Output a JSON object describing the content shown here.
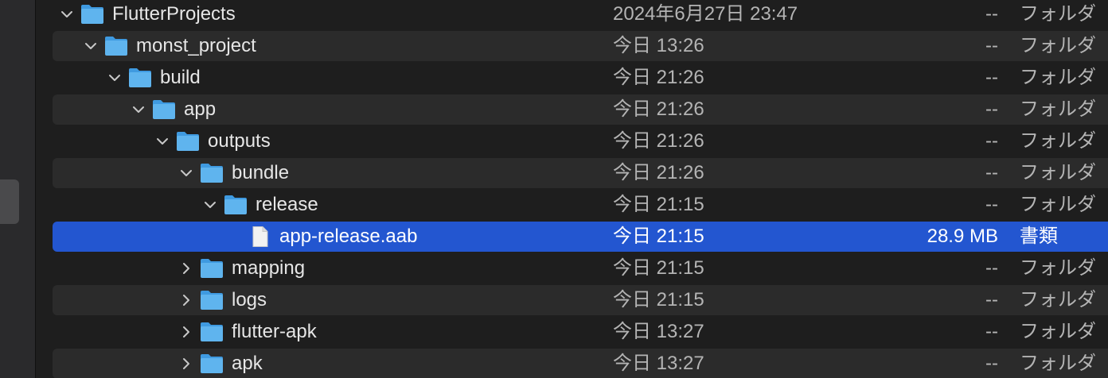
{
  "colors": {
    "background": "#1e1e1e",
    "alt_row": "#2b2b2b",
    "selection": "#2356d0",
    "folder_front": "#5fb4ee",
    "folder_back": "#3f9ae0",
    "text": "#e6e6e6",
    "secondary_text": "#b4b4b4"
  },
  "rows": [
    {
      "name": "FlutterProjects",
      "date": "2024年6月27日 23:47",
      "size": "--",
      "kind": "フォルダ",
      "icon": "folder-icon",
      "disclosure": "expanded",
      "level": 0
    },
    {
      "name": "monst_project",
      "date": "今日 13:26",
      "size": "--",
      "kind": "フォルダ",
      "icon": "folder-icon",
      "disclosure": "expanded",
      "level": 1
    },
    {
      "name": "build",
      "date": "今日 21:26",
      "size": "--",
      "kind": "フォルダ",
      "icon": "folder-icon",
      "disclosure": "expanded",
      "level": 2
    },
    {
      "name": "app",
      "date": "今日 21:26",
      "size": "--",
      "kind": "フォルダ",
      "icon": "folder-icon",
      "disclosure": "expanded",
      "level": 3
    },
    {
      "name": "outputs",
      "date": "今日 21:26",
      "size": "--",
      "kind": "フォルダ",
      "icon": "folder-icon",
      "disclosure": "expanded",
      "level": 4
    },
    {
      "name": "bundle",
      "date": "今日 21:26",
      "size": "--",
      "kind": "フォルダ",
      "icon": "folder-icon",
      "disclosure": "expanded",
      "level": 5
    },
    {
      "name": "release",
      "date": "今日 21:15",
      "size": "--",
      "kind": "フォルダ",
      "icon": "folder-icon",
      "disclosure": "expanded",
      "level": 6
    },
    {
      "name": "app-release.aab",
      "date": "今日 21:15",
      "size": "28.9 MB",
      "kind": "書類",
      "icon": "document-icon",
      "disclosure": "none",
      "level": 7,
      "selected": true
    },
    {
      "name": "mapping",
      "date": "今日 21:15",
      "size": "--",
      "kind": "フォルダ",
      "icon": "folder-icon",
      "disclosure": "collapsed",
      "level": 5
    },
    {
      "name": "logs",
      "date": "今日 21:15",
      "size": "--",
      "kind": "フォルダ",
      "icon": "folder-icon",
      "disclosure": "collapsed",
      "level": 5
    },
    {
      "name": "flutter-apk",
      "date": "今日 13:27",
      "size": "--",
      "kind": "フォルダ",
      "icon": "folder-icon",
      "disclosure": "collapsed",
      "level": 5
    },
    {
      "name": "apk",
      "date": "今日 13:27",
      "size": "--",
      "kind": "フォルダ",
      "icon": "folder-icon",
      "disclosure": "collapsed",
      "level": 5
    }
  ]
}
